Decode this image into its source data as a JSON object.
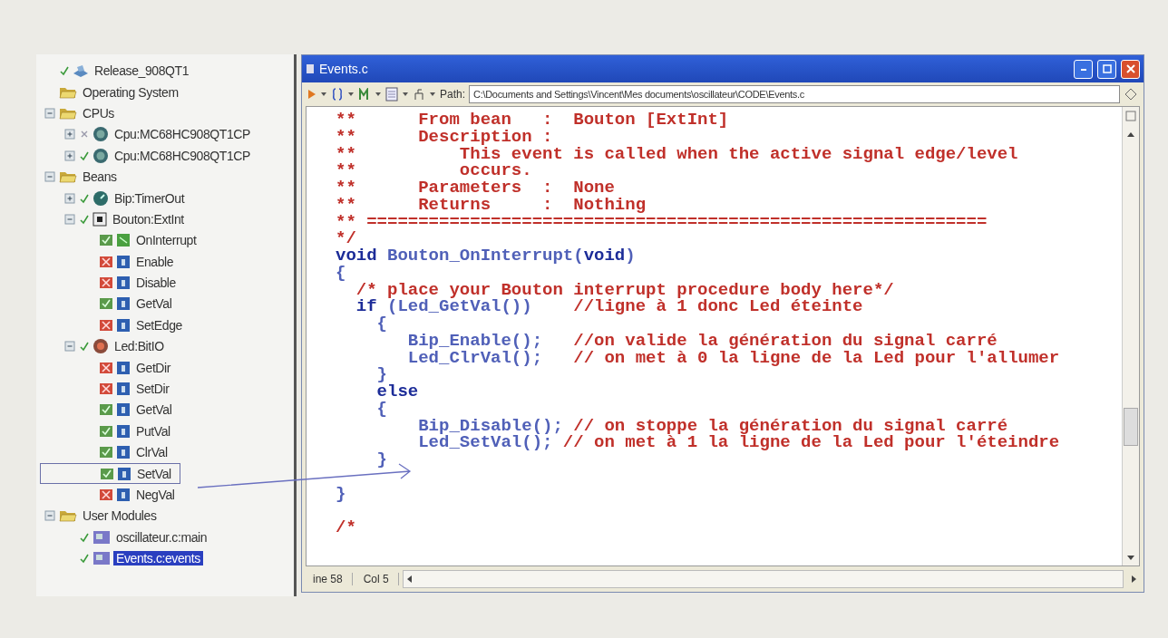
{
  "tree": [
    {
      "label": "Release_908QT1",
      "kind": "build",
      "ok": true,
      "selected": false
    },
    {
      "label": "Operating System",
      "kind": "folder",
      "selected": false
    },
    {
      "label": "CPUs",
      "kind": "folder",
      "expanded": true,
      "selected": false,
      "children": [
        {
          "label": "Cpu:MC68HC908QT1CP",
          "kind": "cpu",
          "expanded": false,
          "ok": false,
          "selected": false
        },
        {
          "label": "Cpu:MC68HC908QT1CP",
          "kind": "cpu",
          "expanded": false,
          "ok": true,
          "selected": false
        }
      ]
    },
    {
      "label": "Beans",
      "kind": "folder",
      "expanded": true,
      "selected": false,
      "children": [
        {
          "label": "Bip:TimerOut",
          "kind": "timer",
          "expanded": false,
          "ok": true,
          "selected": false
        },
        {
          "label": "Bouton:ExtInt",
          "kind": "button",
          "expanded": true,
          "ok": true,
          "selected": false,
          "children": [
            {
              "label": "OnInterrupt",
              "kind": "event",
              "enabled": true,
              "boxed": false,
              "selected": false
            },
            {
              "label": "Enable",
              "kind": "method",
              "enabled": false,
              "boxed": false,
              "selected": false
            },
            {
              "label": "Disable",
              "kind": "method",
              "enabled": false,
              "boxed": false,
              "selected": false
            },
            {
              "label": "GetVal",
              "kind": "method",
              "enabled": true,
              "boxed": false,
              "selected": false
            },
            {
              "label": "SetEdge",
              "kind": "method",
              "enabled": false,
              "boxed": false,
              "selected": false
            }
          ]
        },
        {
          "label": "Led:BitIO",
          "kind": "led",
          "expanded": true,
          "ok": true,
          "selected": false,
          "children": [
            {
              "label": "GetDir",
              "kind": "method",
              "enabled": false,
              "boxed": false,
              "selected": false
            },
            {
              "label": "SetDir",
              "kind": "method",
              "enabled": false,
              "boxed": false,
              "selected": false
            },
            {
              "label": "GetVal",
              "kind": "method",
              "enabled": true,
              "boxed": false,
              "selected": false
            },
            {
              "label": "PutVal",
              "kind": "method",
              "enabled": true,
              "boxed": false,
              "selected": false
            },
            {
              "label": "ClrVal",
              "kind": "method",
              "enabled": true,
              "boxed": false,
              "selected": false
            },
            {
              "label": "SetVal",
              "kind": "method",
              "enabled": true,
              "boxed": true,
              "selected": false
            },
            {
              "label": "NegVal",
              "kind": "method",
              "enabled": false,
              "boxed": false,
              "selected": false
            }
          ]
        }
      ]
    },
    {
      "label": "User Modules",
      "kind": "folder",
      "expanded": true,
      "selected": false,
      "children": [
        {
          "label": "oscillateur.c:main",
          "kind": "module",
          "ok": true,
          "selected": false
        },
        {
          "label": "Events.c:events",
          "kind": "module",
          "ok": true,
          "selected": true
        }
      ]
    }
  ],
  "editor": {
    "title": "Events.c",
    "path_label": "Path:",
    "path": "C:\\Documents and Settings\\Vincent\\Mes documents\\oscillateur\\CODE\\Events.c",
    "lines": [
      {
        "kind": "code",
        "segments": [
          {
            "kind": "comment",
            "text": "**      From bean   :  Bouton [ExtInt]"
          }
        ]
      },
      {
        "kind": "code",
        "segments": [
          {
            "kind": "comment",
            "text": "**      Description :"
          }
        ]
      },
      {
        "kind": "code",
        "segments": [
          {
            "kind": "comment",
            "text": "**          This event is called when the active signal edge/level"
          }
        ]
      },
      {
        "kind": "code",
        "segments": [
          {
            "kind": "comment",
            "text": "**          occurs."
          }
        ]
      },
      {
        "kind": "code",
        "segments": [
          {
            "kind": "comment",
            "text": "**      Parameters  :  None"
          }
        ]
      },
      {
        "kind": "code",
        "segments": [
          {
            "kind": "comment",
            "text": "**      Returns     :  Nothing"
          }
        ]
      },
      {
        "kind": "code",
        "segments": [
          {
            "kind": "comment",
            "text": "** ============================================================"
          }
        ]
      },
      {
        "kind": "code",
        "segments": [
          {
            "kind": "comment",
            "text": "*/"
          }
        ]
      },
      {
        "kind": "code",
        "segments": [
          {
            "kind": "keyword",
            "text": "void"
          },
          {
            "kind": "ident",
            "text": " Bouton_OnInterrupt("
          },
          {
            "kind": "keyword",
            "text": "void"
          },
          {
            "kind": "ident",
            "text": ")"
          }
        ]
      },
      {
        "kind": "code",
        "segments": [
          {
            "kind": "ident",
            "text": "{"
          }
        ]
      },
      {
        "kind": "code",
        "segments": [
          {
            "kind": "comment",
            "text": "  /* place your Bouton interrupt procedure body here*/"
          }
        ]
      },
      {
        "kind": "code",
        "segments": [
          {
            "kind": "keyword",
            "text": "  if"
          },
          {
            "kind": "ident",
            "text": " (Led_GetVal())   "
          },
          {
            "kind": "comment",
            "text": " //ligne à 1 donc Led éteinte"
          }
        ]
      },
      {
        "kind": "code",
        "segments": [
          {
            "kind": "ident",
            "text": "    {"
          }
        ]
      },
      {
        "kind": "code",
        "segments": [
          {
            "kind": "ident",
            "text": "       Bip_Enable();   "
          },
          {
            "kind": "comment",
            "text": "//on valide la génération du signal carré"
          }
        ]
      },
      {
        "kind": "code",
        "segments": [
          {
            "kind": "ident",
            "text": "       Led_ClrVal();   "
          },
          {
            "kind": "comment",
            "text": "// on met à 0 la ligne de la Led pour l'allumer"
          }
        ]
      },
      {
        "kind": "code",
        "segments": [
          {
            "kind": "ident",
            "text": "    }"
          }
        ]
      },
      {
        "kind": "code",
        "segments": [
          {
            "kind": "keyword",
            "text": "    else"
          }
        ]
      },
      {
        "kind": "code",
        "segments": [
          {
            "kind": "ident",
            "text": "    {"
          }
        ]
      },
      {
        "kind": "code",
        "segments": [
          {
            "kind": "ident",
            "text": "        Bip_Disable(); "
          },
          {
            "kind": "comment",
            "text": "// on stoppe la génération du signal carré"
          }
        ]
      },
      {
        "kind": "code",
        "segments": [
          {
            "kind": "ident",
            "text": "        Led_SetVal(); "
          },
          {
            "kind": "comment",
            "text": "// on met à 1 la ligne de la Led pour l'éteindre"
          }
        ]
      },
      {
        "kind": "code",
        "segments": [
          {
            "kind": "ident",
            "text": "    }"
          }
        ]
      },
      {
        "kind": "blank"
      },
      {
        "kind": "code",
        "segments": [
          {
            "kind": "ident",
            "text": "}"
          }
        ]
      },
      {
        "kind": "blank"
      },
      {
        "kind": "code",
        "segments": [
          {
            "kind": "comment",
            "text": "/*"
          }
        ]
      }
    ],
    "status": {
      "line": "ine 58",
      "column": "Col 5"
    }
  }
}
